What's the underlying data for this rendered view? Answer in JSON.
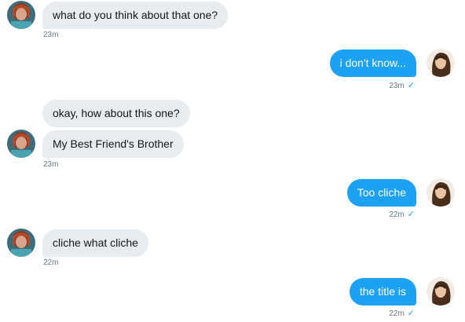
{
  "conversation": {
    "messages": [
      {
        "direction": "in",
        "text": "what do you think about that one?",
        "time": "23m"
      },
      {
        "direction": "out",
        "text": "i don't know...",
        "time": "23m"
      },
      {
        "direction": "in",
        "text": "okay, how about this one?"
      },
      {
        "direction": "in",
        "text": "My Best Friend's Brother",
        "time": "23m"
      },
      {
        "direction": "out",
        "text": "Too cliche",
        "time": "22m"
      },
      {
        "direction": "in",
        "text": "cliche what cliche",
        "time": "22m"
      },
      {
        "direction": "out",
        "text": "the title is",
        "time": "22m"
      }
    ],
    "read_receipt_icon": "checkmark-icon",
    "colors": {
      "incoming_bubble": "#e6ecf0",
      "outgoing_bubble": "#1da1f2",
      "timestamp": "#657786",
      "check": "#1da1f2"
    }
  }
}
